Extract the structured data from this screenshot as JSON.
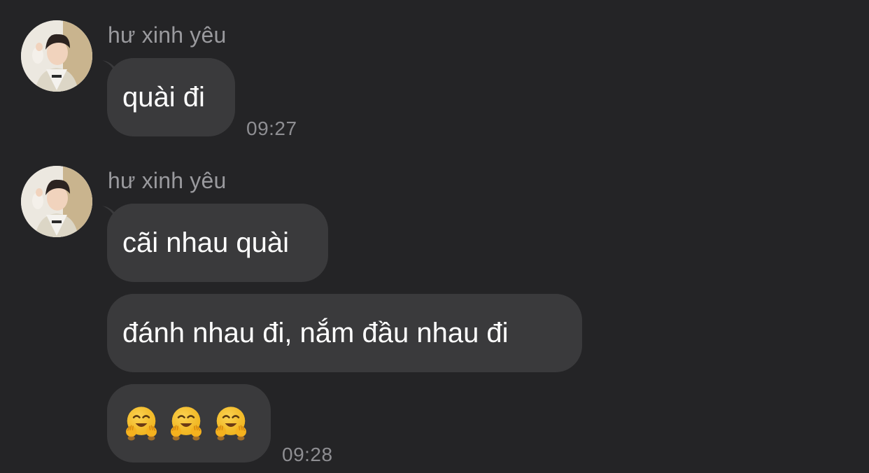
{
  "conversation": {
    "groups": [
      {
        "sender": "hư xinh yêu",
        "messages": [
          {
            "text": "quài đi"
          }
        ],
        "time": "09:27"
      },
      {
        "sender": "hư xinh yêu",
        "messages": [
          {
            "text": "cãi nhau quài"
          },
          {
            "text": "đánh nhau đi, nắm đầu nhau đi"
          },
          {
            "emoji": [
              "hugging-face",
              "hugging-face",
              "hugging-face"
            ]
          }
        ],
        "time": "09:28"
      }
    ]
  },
  "colors": {
    "background": "#242426",
    "bubble": "#3a3a3c",
    "message_text": "#ffffff",
    "sender_text": "#9a9a9e",
    "timestamp_text": "#8e8e92",
    "emoji_face": "#f7c12a"
  }
}
